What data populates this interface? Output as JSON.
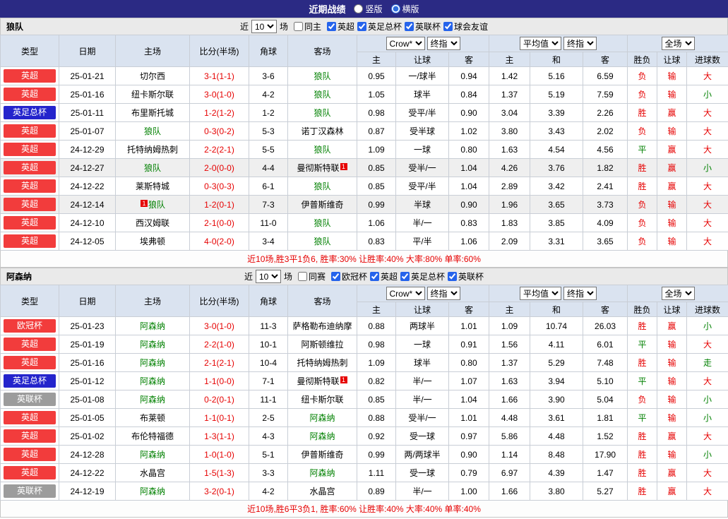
{
  "topbar": {
    "title": "近期战绩",
    "vertical_label": "竖版",
    "horizontal_label": "横版"
  },
  "sections": [
    {
      "team": "狼队",
      "filters": {
        "near": "近",
        "count": "10",
        "unit": "场",
        "same": "同主",
        "leagues": [
          "英超",
          "英足总杯",
          "英联杯",
          "球会友谊"
        ]
      },
      "head": {
        "type": "类型",
        "date": "日期",
        "home": "主场",
        "score": "比分(半场)",
        "corner": "角球",
        "away": "客场",
        "sel_source": "Crow*",
        "sel_final": "终指",
        "sel_avg": "平均值",
        "sel_full": "全场",
        "sub": [
          "主",
          "让球",
          "客",
          "主",
          "和",
          "客",
          "胜负",
          "让球",
          "进球数"
        ]
      },
      "rows": [
        {
          "type": "英超",
          "badge": "red",
          "date": "25-01-21",
          "home": "切尔西",
          "score": "3-1(1-1)",
          "corner": "3-6",
          "away": "狼队",
          "away_focus": true,
          "o1": "0.95",
          "let": "一/球半",
          "o2": "0.94",
          "m1": "1.42",
          "m2": "5.16",
          "m3": "6.59",
          "r": "负",
          "rl": "输",
          "rg": "大"
        },
        {
          "type": "英超",
          "badge": "red",
          "date": "25-01-16",
          "home": "纽卡斯尔联",
          "score": "3-0(1-0)",
          "corner": "4-2",
          "away": "狼队",
          "away_focus": true,
          "o1": "1.05",
          "let": "球半",
          "o2": "0.84",
          "m1": "1.37",
          "m2": "5.19",
          "m3": "7.59",
          "r": "负",
          "rl": "输",
          "rg": "小"
        },
        {
          "type": "英足总杯",
          "badge": "blue",
          "date": "25-01-11",
          "home": "布里斯托城",
          "score": "1-2(1-2)",
          "corner": "1-2",
          "away": "狼队",
          "away_focus": true,
          "o1": "0.98",
          "let": "受平/半",
          "o2": "0.90",
          "m1": "3.04",
          "m2": "3.39",
          "m3": "2.26",
          "r": "胜",
          "rl": "赢",
          "rg": "大"
        },
        {
          "type": "英超",
          "badge": "red",
          "date": "25-01-07",
          "home": "狼队",
          "home_focus": true,
          "score": "0-3(0-2)",
          "corner": "5-3",
          "away": "诺丁汉森林",
          "o1": "0.87",
          "let": "受半球",
          "o2": "1.02",
          "m1": "3.80",
          "m2": "3.43",
          "m3": "2.02",
          "r": "负",
          "rl": "输",
          "rg": "大"
        },
        {
          "type": "英超",
          "badge": "red",
          "date": "24-12-29",
          "home": "托特纳姆热刺",
          "score": "2-2(2-1)",
          "corner": "5-5",
          "away": "狼队",
          "away_focus": true,
          "o1": "1.09",
          "let": "一球",
          "o2": "0.80",
          "m1": "1.63",
          "m2": "4.54",
          "m3": "4.56",
          "r": "平",
          "rl": "赢",
          "rg": "大"
        },
        {
          "type": "英超",
          "badge": "red",
          "date": "24-12-27",
          "home": "狼队",
          "home_focus": true,
          "score": "2-0(0-0)",
          "corner": "4-4",
          "away": "曼彻斯特联",
          "away_note_after": "1",
          "o1": "0.85",
          "let": "受半/一",
          "o2": "1.04",
          "m1": "4.26",
          "m2": "3.76",
          "m3": "1.82",
          "r": "胜",
          "rl": "赢",
          "rg": "小",
          "hl": true
        },
        {
          "type": "英超",
          "badge": "red",
          "date": "24-12-22",
          "home": "莱斯特城",
          "score": "0-3(0-3)",
          "corner": "6-1",
          "away": "狼队",
          "away_focus": true,
          "o1": "0.85",
          "let": "受平/半",
          "o2": "1.04",
          "m1": "2.89",
          "m2": "3.42",
          "m3": "2.41",
          "r": "胜",
          "rl": "赢",
          "rg": "大"
        },
        {
          "type": "英超",
          "badge": "red",
          "date": "24-12-14",
          "home": "狼队",
          "home_focus": true,
          "home_note_before": "1",
          "score": "1-2(0-1)",
          "corner": "7-3",
          "away": "伊普斯维奇",
          "o1": "0.99",
          "let": "半球",
          "o2": "0.90",
          "m1": "1.96",
          "m2": "3.65",
          "m3": "3.73",
          "r": "负",
          "rl": "输",
          "rg": "大",
          "hl": true
        },
        {
          "type": "英超",
          "badge": "red",
          "date": "24-12-10",
          "home": "西汉姆联",
          "score": "2-1(0-0)",
          "corner": "11-0",
          "away": "狼队",
          "away_focus": true,
          "o1": "1.06",
          "let": "半/一",
          "o2": "0.83",
          "m1": "1.83",
          "m2": "3.85",
          "m3": "4.09",
          "r": "负",
          "rl": "输",
          "rg": "大"
        },
        {
          "type": "英超",
          "badge": "red",
          "date": "24-12-05",
          "home": "埃弗顿",
          "score": "4-0(2-0)",
          "corner": "3-4",
          "away": "狼队",
          "away_focus": true,
          "o1": "0.83",
          "let": "平/半",
          "o2": "1.06",
          "m1": "2.09",
          "m2": "3.31",
          "m3": "3.65",
          "r": "负",
          "rl": "输",
          "rg": "大"
        }
      ],
      "summary": "近10场,胜3平1负6, 胜率:30% 让胜率:40% 大率:80% 单率:60%"
    },
    {
      "team": "阿森纳",
      "filters": {
        "near": "近",
        "count": "10",
        "unit": "场",
        "same": "同赛",
        "leagues": [
          "欧冠杯",
          "英超",
          "英足总杯",
          "英联杯"
        ]
      },
      "head": {
        "type": "类型",
        "date": "日期",
        "home": "主场",
        "score": "比分(半场)",
        "corner": "角球",
        "away": "客场",
        "sel_source": "Crow*",
        "sel_final": "终指",
        "sel_avg": "平均值",
        "sel_full": "全场",
        "sub": [
          "主",
          "让球",
          "客",
          "主",
          "和",
          "客",
          "胜负",
          "让球",
          "进球数"
        ]
      },
      "rows": [
        {
          "type": "欧冠杯",
          "badge": "red",
          "date": "25-01-23",
          "home": "阿森纳",
          "home_focus": true,
          "score": "3-0(1-0)",
          "corner": "11-3",
          "away": "萨格勒布迪纳摩",
          "o1": "0.88",
          "let": "两球半",
          "o2": "1.01",
          "m1": "1.09",
          "m2": "10.74",
          "m3": "26.03",
          "r": "胜",
          "rl": "赢",
          "rg": "小"
        },
        {
          "type": "英超",
          "badge": "red",
          "date": "25-01-19",
          "home": "阿森纳",
          "home_focus": true,
          "score": "2-2(1-0)",
          "corner": "10-1",
          "away": "阿斯顿维拉",
          "o1": "0.98",
          "let": "一球",
          "o2": "0.91",
          "m1": "1.56",
          "m2": "4.11",
          "m3": "6.01",
          "r": "平",
          "rl": "输",
          "rg": "大"
        },
        {
          "type": "英超",
          "badge": "red",
          "date": "25-01-16",
          "home": "阿森纳",
          "home_focus": true,
          "score": "2-1(2-1)",
          "corner": "10-4",
          "away": "托特纳姆热刺",
          "o1": "1.09",
          "let": "球半",
          "o2": "0.80",
          "m1": "1.37",
          "m2": "5.29",
          "m3": "7.48",
          "r": "胜",
          "rl": "输",
          "rg": "走"
        },
        {
          "type": "英足总杯",
          "badge": "blue",
          "date": "25-01-12",
          "home": "阿森纳",
          "home_focus": true,
          "score": "1-1(0-0)",
          "corner": "7-1",
          "away": "曼彻斯特联",
          "away_note_after": "1",
          "o1": "0.82",
          "let": "半/一",
          "o2": "1.07",
          "m1": "1.63",
          "m2": "3.94",
          "m3": "5.10",
          "r": "平",
          "rl": "输",
          "rg": "大"
        },
        {
          "type": "英联杯",
          "badge": "gray",
          "date": "25-01-08",
          "home": "阿森纳",
          "home_focus": true,
          "score": "0-2(0-1)",
          "corner": "11-1",
          "away": "纽卡斯尔联",
          "o1": "0.85",
          "let": "半/一",
          "o2": "1.04",
          "m1": "1.66",
          "m2": "3.90",
          "m3": "5.04",
          "r": "负",
          "rl": "输",
          "rg": "小"
        },
        {
          "type": "英超",
          "badge": "red",
          "date": "25-01-05",
          "home": "布莱顿",
          "score": "1-1(0-1)",
          "corner": "2-5",
          "away": "阿森纳",
          "away_focus": true,
          "o1": "0.88",
          "let": "受半/一",
          "o2": "1.01",
          "m1": "4.48",
          "m2": "3.61",
          "m3": "1.81",
          "r": "平",
          "rl": "输",
          "rg": "小"
        },
        {
          "type": "英超",
          "badge": "red",
          "date": "25-01-02",
          "home": "布伦特福德",
          "score": "1-3(1-1)",
          "corner": "4-3",
          "away": "阿森纳",
          "away_focus": true,
          "o1": "0.92",
          "let": "受一球",
          "o2": "0.97",
          "m1": "5.86",
          "m2": "4.48",
          "m3": "1.52",
          "r": "胜",
          "rl": "赢",
          "rg": "大"
        },
        {
          "type": "英超",
          "badge": "red",
          "date": "24-12-28",
          "home": "阿森纳",
          "home_focus": true,
          "score": "1-0(1-0)",
          "corner": "5-1",
          "away": "伊普斯维奇",
          "o1": "0.99",
          "let": "两/两球半",
          "o2": "0.90",
          "m1": "1.14",
          "m2": "8.48",
          "m3": "17.90",
          "r": "胜",
          "rl": "输",
          "rg": "小"
        },
        {
          "type": "英超",
          "badge": "red",
          "date": "24-12-22",
          "home": "水晶宫",
          "score": "1-5(1-3)",
          "corner": "3-3",
          "away": "阿森纳",
          "away_focus": true,
          "o1": "1.11",
          "let": "受一球",
          "o2": "0.79",
          "m1": "6.97",
          "m2": "4.39",
          "m3": "1.47",
          "r": "胜",
          "rl": "赢",
          "rg": "大"
        },
        {
          "type": "英联杯",
          "badge": "gray",
          "date": "24-12-19",
          "home": "阿森纳",
          "home_focus": true,
          "score": "3-2(0-1)",
          "corner": "4-2",
          "away": "水晶宫",
          "o1": "0.89",
          "let": "半/一",
          "o2": "1.00",
          "m1": "1.66",
          "m2": "3.80",
          "m3": "5.27",
          "r": "胜",
          "rl": "赢",
          "rg": "大"
        }
      ],
      "summary": "近10场,胜6平3负1, 胜率:60% 让胜率:40% 大率:40% 单率:40%"
    }
  ]
}
